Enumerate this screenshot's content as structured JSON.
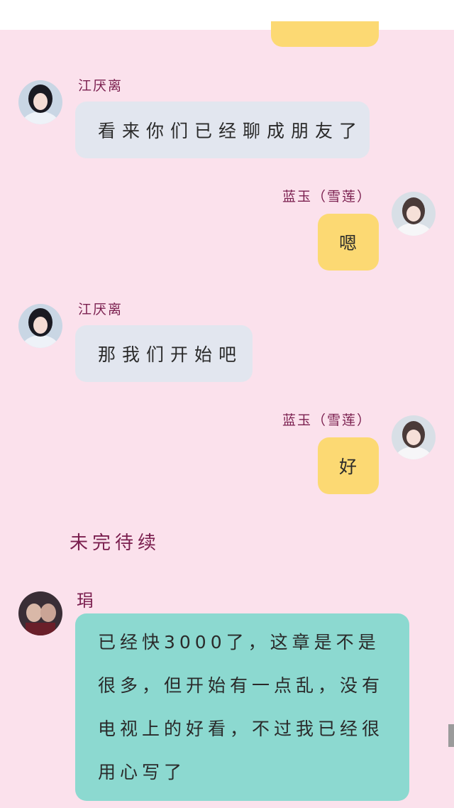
{
  "messages": [
    {
      "side": "left",
      "sender": "江厌离",
      "text": "看来你们已经聊成朋友了"
    },
    {
      "side": "right",
      "sender": "蓝玉（雪莲）",
      "text": "嗯"
    },
    {
      "side": "left",
      "sender": "江厌离",
      "text": "那我们开始吧"
    },
    {
      "side": "right",
      "sender": "蓝玉（雪莲）",
      "text": "好"
    }
  ],
  "to_be_continued": "未完待续",
  "author_note": {
    "sender": "琄",
    "text": "已经快3000了，这章是不是很多，但开始有一点乱，没有电视上的好看，不过我已经很用心写了"
  },
  "colors": {
    "background": "#fbe1ec",
    "left_bubble": "#e2e6ef",
    "right_bubble": "#fcd973",
    "note_bubble": "#8cd9d0",
    "name_text": "#7a1e4e"
  }
}
